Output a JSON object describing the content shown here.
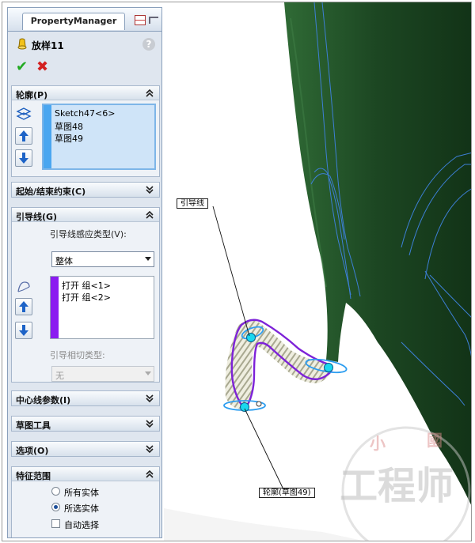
{
  "panel": {
    "tab_label": "PropertyManager",
    "feature_title": "放样11",
    "help_label": "?",
    "ok_label": "✔",
    "cancel_label": "✖"
  },
  "sections": {
    "profile": {
      "title": "轮廓(P)",
      "items": [
        "Sketch47<6>",
        "草图48",
        "草图49"
      ]
    },
    "start_end": {
      "title": "起始/结束约束(C)"
    },
    "guides": {
      "title": "引导线(G)",
      "influence_label": "引导线感应类型(V):",
      "influence_value": "整体",
      "items": [
        "打开 组<1>",
        "打开 组<2>"
      ],
      "tangency_label": "引导相切类型:",
      "tangency_value": "无"
    },
    "centerline": {
      "title": "中心线参数(I)"
    },
    "sketch_tools": {
      "title": "草图工具"
    },
    "options": {
      "title": "选项(O)"
    },
    "feature_scope": {
      "title": "特征范围",
      "all_bodies": "所有实体",
      "selected_bodies": "所选实体",
      "auto_select": "自动选择",
      "selected_option": "所选实体"
    }
  },
  "viewport": {
    "guide_callout": "引导线",
    "profile_callout": "轮廓(草图49)",
    "watermark_text": "工程师",
    "watermark_small": [
      "小",
      "國"
    ]
  },
  "colors": {
    "panel_bg": "#dfe6ef",
    "selection_blue": "#cfe4f8",
    "stripe_blue": "#4aa6f0",
    "stripe_purple": "#8b1cf0",
    "solid_green": "#1f4a26",
    "guide_curve_purple": "#7d22d8",
    "preview_blue": "#2c9df0",
    "highlight_cyan": "#19d8ef"
  }
}
